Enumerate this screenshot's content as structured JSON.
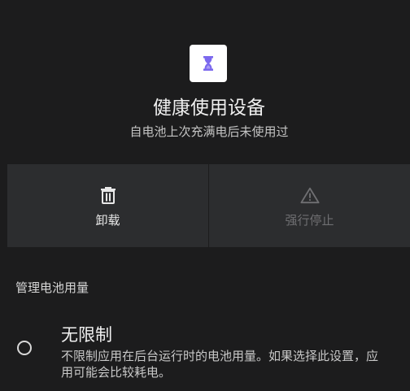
{
  "app": {
    "title": "健康使用设备",
    "subtitle": "自电池上次充满电后未使用过",
    "icon": "hourglass-icon",
    "icon_color": "#7b68ee"
  },
  "actions": {
    "uninstall": {
      "label": "卸载",
      "icon": "trash-icon",
      "enabled": true
    },
    "force_stop": {
      "label": "强行停止",
      "icon": "warning-icon",
      "enabled": false
    }
  },
  "battery_section": {
    "header": "管理电池用量",
    "options": [
      {
        "title": "无限制",
        "description": "不限制应用在后台运行时的电池用量。如果选择此设置，应用可能会比较耗电。",
        "selected": false
      }
    ]
  },
  "colors": {
    "background": "#1c1c1d",
    "button_surface": "#2c2d2f",
    "disabled_text": "#6f6f72"
  }
}
